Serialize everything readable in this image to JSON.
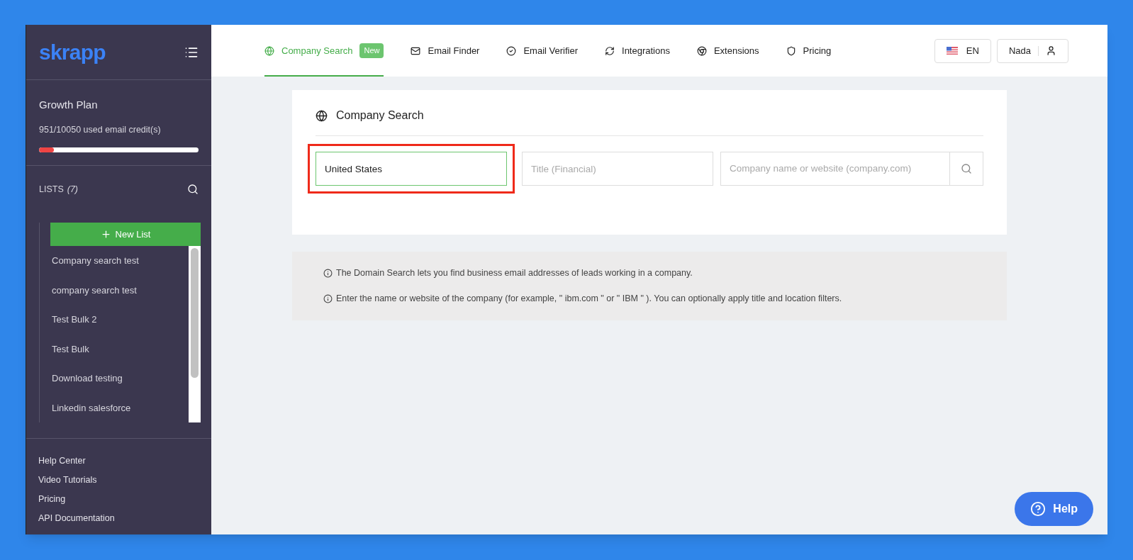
{
  "sidebar": {
    "logo": "skrapp",
    "plan": {
      "name": "Growth Plan",
      "credits": "951/10050 used email credit(s)",
      "level": 0.095
    },
    "lists": {
      "label": "LISTS",
      "count": "(7)",
      "new_button": "New List",
      "items": [
        {
          "name": "Company search test"
        },
        {
          "name": "company search test"
        },
        {
          "name": "Test Bulk 2"
        },
        {
          "name": "Test Bulk"
        },
        {
          "name": "Download testing"
        },
        {
          "name": "Linkedin salesforce"
        }
      ]
    },
    "links": [
      "Help Center",
      "Video Tutorials",
      "Pricing",
      "API Documentation"
    ]
  },
  "nav": {
    "tabs": [
      {
        "label": "Company Search",
        "badge": "New",
        "selected": true
      },
      {
        "label": "Email Finder",
        "selected": false
      },
      {
        "label": "Email Verifier",
        "selected": false
      },
      {
        "label": "Integrations",
        "selected": false
      },
      {
        "label": "Extensions",
        "selected": false
      },
      {
        "label": "Pricing",
        "selected": false
      }
    ],
    "language": "EN",
    "user": "Nada"
  },
  "search_card": {
    "title": "Company Search",
    "fields": [
      {
        "value": "United States",
        "highlighted": true
      },
      {
        "placeholder": "Title (Financial)",
        "highlighted": false
      },
      {
        "placeholder": "Company name or website (company.com)",
        "highlighted": false
      }
    ]
  },
  "info": [
    "The Domain Search lets you find business email addresses of leads working in a company.",
    "Enter the name or website of the company (for example, \" ibm.com \" or \" IBM \" ). You can optionally apply title and location filters."
  ],
  "help_button": "Help"
}
